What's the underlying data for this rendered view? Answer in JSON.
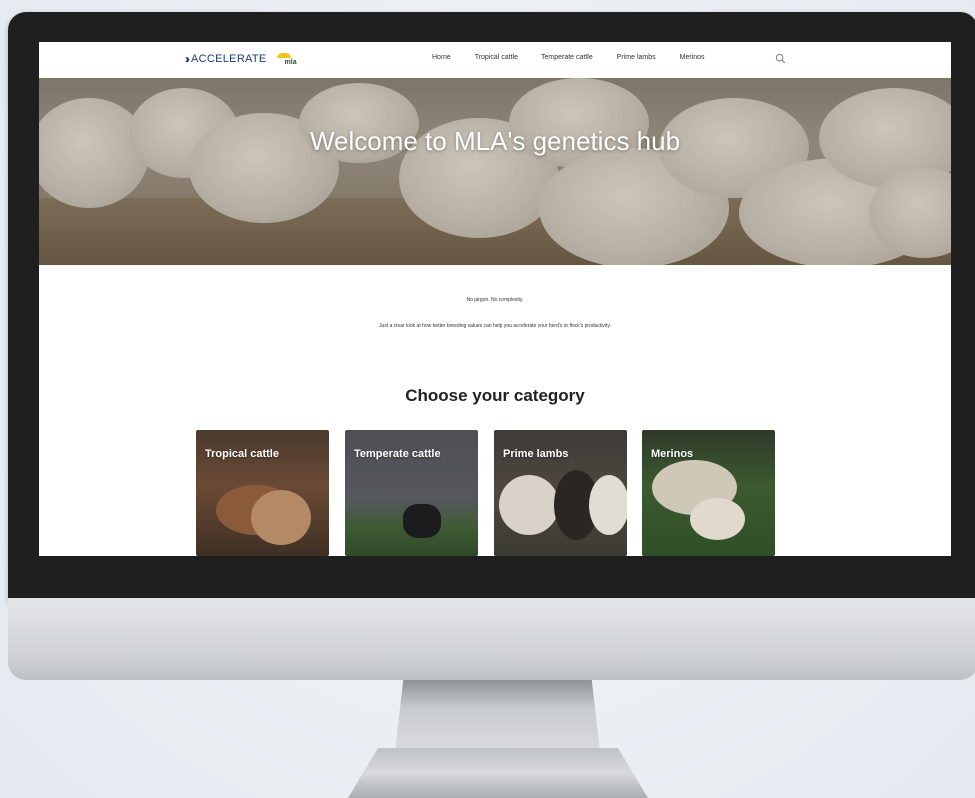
{
  "header": {
    "logo_text": "ACCELERATE",
    "partner_logo_text": "mla",
    "nav_items": [
      {
        "label": "Home"
      },
      {
        "label": "Tropical cattle"
      },
      {
        "label": "Temperate cattle"
      },
      {
        "label": "Prime lambs"
      },
      {
        "label": "Merinos"
      }
    ],
    "search_icon": "search-icon"
  },
  "hero": {
    "title": "Welcome to MLA's genetics hub"
  },
  "intro": {
    "line1": "No jargon. No complexity.",
    "line2": "Just a clear look at how better breeding values can help you accelerate your herd's or flock's productivity."
  },
  "categories": {
    "title": "Choose your category",
    "cards": [
      {
        "label": "Tropical cattle"
      },
      {
        "label": "Temperate cattle"
      },
      {
        "label": "Prime lambs"
      },
      {
        "label": "Merinos"
      }
    ]
  },
  "colors": {
    "brand_navy": "#1b3c73",
    "mla_yellow": "#f3c316",
    "monitor_bezel": "#1f1f1f"
  }
}
